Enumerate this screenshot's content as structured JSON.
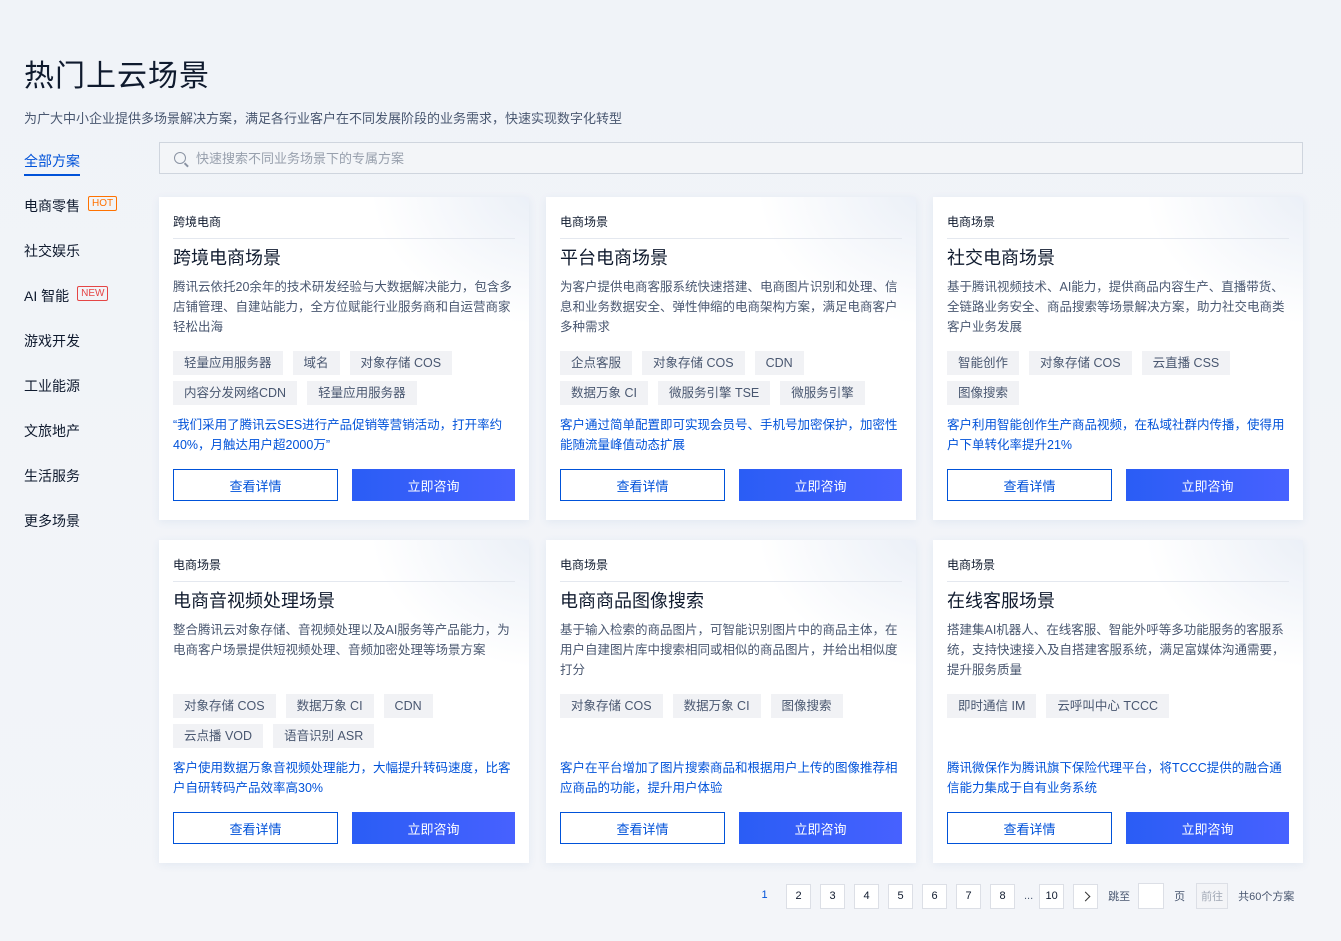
{
  "header": {
    "title": "热门上云场景",
    "subtitle": "为广大中小企业提供多场景解决方案，满足各行业客户在不同发展阶段的业务需求，快速实现数字化转型"
  },
  "sidebar": {
    "items": [
      {
        "label": "全部方案",
        "active": true
      },
      {
        "label": "电商零售",
        "badge": "HOT"
      },
      {
        "label": "社交娱乐"
      },
      {
        "label": "AI 智能",
        "badge": "NEW"
      },
      {
        "label": "游戏开发"
      },
      {
        "label": "工业能源"
      },
      {
        "label": "文旅地产"
      },
      {
        "label": "生活服务"
      },
      {
        "label": "更多场景"
      }
    ]
  },
  "search": {
    "placeholder": "快速搜索不同业务场景下的专属方案",
    "icon": "search-icon"
  },
  "buttons": {
    "detail": "查看详情",
    "consult": "立即咨询"
  },
  "cards": [
    {
      "category": "跨境电商",
      "title": "跨境电商场景",
      "desc": "腾讯云依托20余年的技术研发经验与大数据解决能力，包含多店铺管理、自建站能力，全方位赋能行业服务商和自运营商家轻松出海",
      "tags": [
        "轻量应用服务器",
        "域名",
        "对象存储 COS",
        "内容分发网络CDN",
        "轻量应用服务器"
      ],
      "quote": "“我们采用了腾讯云SES进行产品促销等营销活动，打开率约40%，月触达用户超2000万”"
    },
    {
      "category": "电商场景",
      "title": "平台电商场景",
      "desc": "为客户提供电商客服系统快速搭建、电商图片识别和处理、信息和业务数据安全、弹性伸缩的电商架构方案，满足电商客户多种需求",
      "tags": [
        "企点客服",
        "对象存储 COS",
        "CDN",
        "数据万象 CI",
        "微服务引擎 TSE",
        "微服务引擎"
      ],
      "quote": "客户通过简单配置即可实现会员号、手机号加密保护，加密性能随流量峰值动态扩展"
    },
    {
      "category": "电商场景",
      "title": "社交电商场景",
      "desc": "基于腾讯视频技术、AI能力，提供商品内容生产、直播带货、全链路业务安全、商品搜索等场景解决方案，助力社交电商类客户业务发展",
      "tags": [
        "智能创作",
        "对象存储 COS",
        "云直播 CSS",
        "图像搜索"
      ],
      "quote": "客户利用智能创作生产商品视频，在私域社群内传播，使得用户下单转化率提升21%"
    },
    {
      "category": "电商场景",
      "title": "电商音视频处理场景",
      "desc": "整合腾讯云对象存储、音视频处理以及AI服务等产品能力，为电商客户场景提供短视频处理、音频加密处理等场景方案",
      "tags": [
        "对象存储 COS",
        "数据万象 CI",
        "CDN",
        "云点播 VOD",
        "语音识别 ASR"
      ],
      "quote": "客户使用数据万象音视频处理能力，大幅提升转码速度，比客户自研转码产品效率高30%"
    },
    {
      "category": "电商场景",
      "title": "电商商品图像搜索",
      "desc": "基于输入检索的商品图片，可智能识别图片中的商品主体，在用户自建图片库中搜索相同或相似的商品图片，并给出相似度打分",
      "tags": [
        "对象存储 COS",
        "数据万象 CI",
        "图像搜索"
      ],
      "quote": "客户在平台增加了图片搜索商品和根据用户上传的图像推荐相应商品的功能，提升用户体验"
    },
    {
      "category": "电商场景",
      "title": "在线客服场景",
      "desc": "搭建集AI机器人、在线客服、智能外呼等多功能服务的客服系统，支持快速接入及自搭建客服系统，满足富媒体沟通需要，提升服务质量",
      "tags": [
        "即时通信 IM",
        "云呼叫中心 TCCC"
      ],
      "quote": "腾讯微保作为腾讯旗下保险代理平台，将TCCC提供的融合通信能力集成于自有业务系统"
    }
  ],
  "pagination": {
    "pages": [
      "1",
      "2",
      "3",
      "4",
      "5",
      "6",
      "7",
      "8"
    ],
    "ellipsis": "...",
    "last": "10",
    "current": "1",
    "jump_label": "跳至",
    "page_label": "页",
    "go_label": "前往",
    "total": "共60个方案"
  }
}
